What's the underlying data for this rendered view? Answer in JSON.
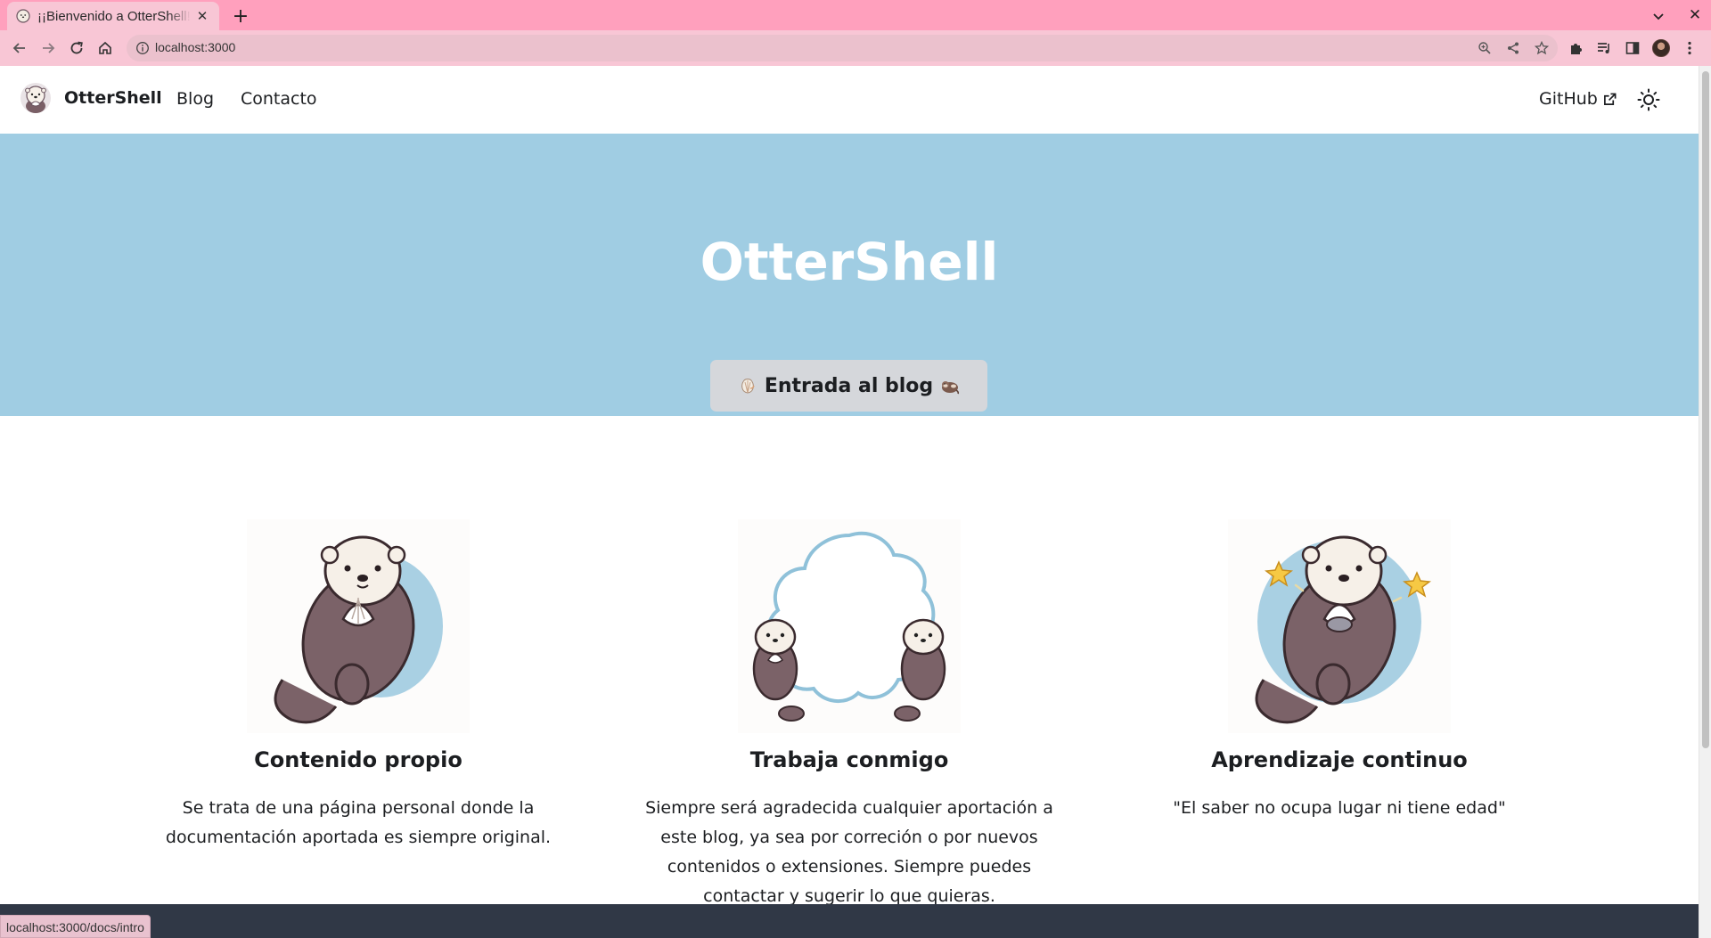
{
  "browser": {
    "tab_title": "¡¡Bienvenido a OtterShell!!",
    "url": "localhost:3000",
    "status_url": "localhost:3000/docs/intro",
    "chrome_color": "#ffa0bd",
    "toolbar_color": "#f8c6d5"
  },
  "nav": {
    "brand": "OtterShell",
    "links": [
      {
        "label": "Blog"
      },
      {
        "label": "Contacto"
      }
    ],
    "github": "GitHub",
    "theme_toggle_icon": "sun-icon"
  },
  "hero": {
    "title": "OtterShell",
    "button_label": "Entrada al blog",
    "button_left_emoji": "shell-icon",
    "button_right_emoji": "otter-icon",
    "background": "#a0cde3"
  },
  "features": [
    {
      "title": "Contenido propio",
      "text": "Se trata de una página personal donde la documentación aportada es siempre original.",
      "image": "otter-holding-shell-illustration"
    },
    {
      "title": "Trabaja conmigo",
      "text": "Siempre será agradecida cualquier aportación a este blog, ya sea por correción o por nuevos contenidos o extensiones. Siempre puedes contactar y sugerir lo que quieras.",
      "image": "two-otters-cloud-illustration"
    },
    {
      "title": "Aprendizaje continuo",
      "text": "\"El saber no ocupa lugar ni tiene edad\"",
      "image": "otter-with-stars-illustration"
    }
  ],
  "footer_color": "#303846"
}
